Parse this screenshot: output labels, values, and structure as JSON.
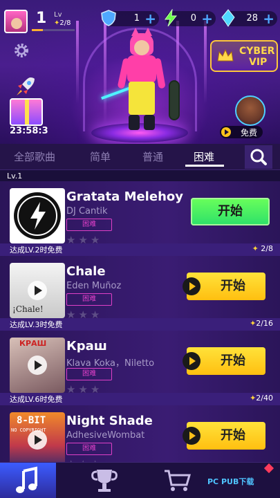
{
  "header": {
    "level": "1",
    "lv_label": "Lv",
    "lv_progress": "2/8",
    "xp_fraction": 0.25,
    "shields": "1",
    "energy": "0",
    "gems": "28"
  },
  "side": {
    "timer": "23:58:3",
    "vip_line1": "CYBER",
    "vip_line2": "VIP",
    "free_label": "免费"
  },
  "tabs": {
    "items": [
      "全部歌曲",
      "简单",
      "普通",
      "困难"
    ],
    "active_index": 3
  },
  "list": {
    "level_header": "Lv.1",
    "songs": [
      {
        "title": "Gratata Melehoy",
        "artist": "DJ Cantik",
        "difficulty": "困难",
        "button": "开始",
        "button_style": "green"
      },
      {
        "title": "Chale",
        "artist": "Eden Muñoz",
        "difficulty": "困难",
        "button": "开始",
        "button_style": "yellow",
        "cover_text": "¡Chale!"
      },
      {
        "title": "Краш",
        "artist": "Klava Koka，Niletto",
        "difficulty": "困难",
        "button": "开始",
        "button_style": "yellow",
        "cover_text": "КРАШ"
      },
      {
        "title": "Night Shade",
        "artist": "AdhesiveWombat",
        "difficulty": "困难",
        "button": "开始",
        "button_style": "yellow",
        "cover_text": "8-BIT",
        "cover_text2": "NO COPYRIGHT"
      }
    ],
    "unlocks": [
      {
        "label": "达成LV.2时免费",
        "progress": "2/8"
      },
      {
        "label": "达成LV.3时免费",
        "progress": "2/16"
      },
      {
        "label": "达成LV.6时免费",
        "progress": "2/40"
      }
    ]
  },
  "watermark": "PC PUB下载",
  "colors": {
    "accent_pink": "#e040c8",
    "start_green": "#2ce06a",
    "start_yellow": "#ffbf10",
    "vip_gold": "#ffc83a"
  }
}
